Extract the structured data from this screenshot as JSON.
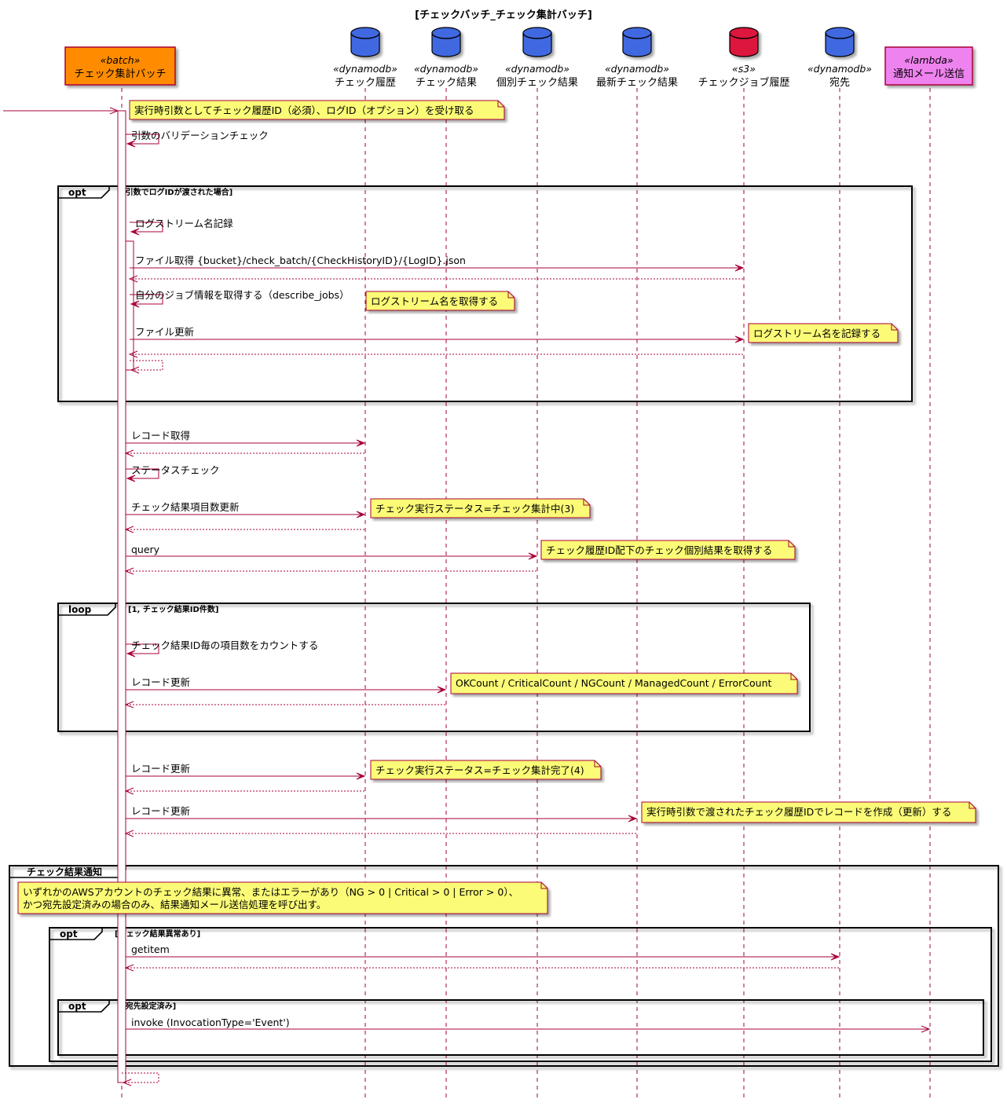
{
  "title": "[チェックバッチ_チェック集計バッチ]",
  "colors": {
    "arrow": "#a80036",
    "note_fill": "#fbfb77",
    "note_stroke": "#a80036",
    "batch": "#ff8c00",
    "lambda": "#ee82ee",
    "dynamodb": "#4169e1",
    "s3": "#dc143c",
    "frame": "#000000"
  },
  "participants": [
    {
      "id": "batch",
      "stereotype": "«batch»",
      "name": "チェック集計バッチ",
      "kind": "box",
      "color": "#ff8c00"
    },
    {
      "id": "hist",
      "stereotype": "«dynamodb»",
      "name": "チェック履歴",
      "kind": "db",
      "color": "#4169e1"
    },
    {
      "id": "result",
      "stereotype": "«dynamodb»",
      "name": "チェック結果",
      "kind": "db",
      "color": "#4169e1"
    },
    {
      "id": "indiv",
      "stereotype": "«dynamodb»",
      "name": "個別チェック結果",
      "kind": "db",
      "color": "#4169e1"
    },
    {
      "id": "latest",
      "stereotype": "«dynamodb»",
      "name": "最新チェック結果",
      "kind": "db",
      "color": "#4169e1"
    },
    {
      "id": "s3",
      "stereotype": "«s3»",
      "name": "チェックジョブ履歴",
      "kind": "db",
      "color": "#dc143c"
    },
    {
      "id": "dest",
      "stereotype": "«dynamodb»",
      "name": "宛先",
      "kind": "db",
      "color": "#4169e1"
    },
    {
      "id": "lambda",
      "stereotype": "«lambda»",
      "name": "通知メール送信",
      "kind": "box",
      "color": "#ee82ee"
    }
  ],
  "messages": [
    {
      "label": "",
      "from": "start",
      "to": "batch",
      "style": "async"
    },
    {
      "label": "引数のバリデーションチェック",
      "from": "batch",
      "to": "batch",
      "style": "self"
    },
    {
      "label": "ログストリーム名記録",
      "from": "batch",
      "to": "batch",
      "style": "self"
    },
    {
      "label": "ファイル取得 {bucket}/check_batch/{CheckHistoryID}/{LogID}.json",
      "from": "batch",
      "to": "s3",
      "style": "sync"
    },
    {
      "label": "",
      "from": "s3",
      "to": "batch",
      "style": "return"
    },
    {
      "label": "自分のジョブ情報を取得する（describe_jobs）",
      "from": "batch",
      "to": "batch",
      "style": "self"
    },
    {
      "label": "ファイル更新",
      "from": "batch",
      "to": "s3",
      "style": "sync"
    },
    {
      "label": "",
      "from": "s3",
      "to": "batch",
      "style": "return"
    },
    {
      "label": "",
      "from": "batch",
      "to": "batch",
      "style": "self-return"
    },
    {
      "label": "レコード取得",
      "from": "batch",
      "to": "hist",
      "style": "sync"
    },
    {
      "label": "",
      "from": "hist",
      "to": "batch",
      "style": "return"
    },
    {
      "label": "ステータスチェック",
      "from": "batch",
      "to": "batch",
      "style": "self"
    },
    {
      "label": "チェック結果項目数更新",
      "from": "batch",
      "to": "hist",
      "style": "sync"
    },
    {
      "label": "",
      "from": "hist",
      "to": "batch",
      "style": "return"
    },
    {
      "label": "query",
      "from": "batch",
      "to": "indiv",
      "style": "sync"
    },
    {
      "label": "",
      "from": "indiv",
      "to": "batch",
      "style": "return"
    },
    {
      "label": "チェック結果ID毎の項目数をカウントする",
      "from": "batch",
      "to": "batch",
      "style": "self"
    },
    {
      "label": "レコード更新",
      "from": "batch",
      "to": "result",
      "style": "sync"
    },
    {
      "label": "",
      "from": "result",
      "to": "batch",
      "style": "return"
    },
    {
      "label": "レコード更新",
      "from": "batch",
      "to": "hist",
      "style": "sync"
    },
    {
      "label": "",
      "from": "hist",
      "to": "batch",
      "style": "return"
    },
    {
      "label": "レコード更新",
      "from": "batch",
      "to": "latest",
      "style": "sync"
    },
    {
      "label": "",
      "from": "latest",
      "to": "batch",
      "style": "return"
    },
    {
      "label": "getitem",
      "from": "batch",
      "to": "dest",
      "style": "sync"
    },
    {
      "label": "",
      "from": "dest",
      "to": "batch",
      "style": "return"
    },
    {
      "label": "invoke (InvocationType='Event')",
      "from": "batch",
      "to": "lambda",
      "style": "async"
    },
    {
      "label": "",
      "from": "batch",
      "to": "batch",
      "style": "self-return"
    }
  ],
  "notes": [
    {
      "lines": [
        "実行時引数としてチェック履歴ID（必須）、ログID（オプション）を受け取る"
      ]
    },
    {
      "lines": [
        "ログストリーム名を取得する"
      ]
    },
    {
      "lines": [
        "ログストリーム名を記録する"
      ]
    },
    {
      "lines": [
        "チェック実行ステータス=チェック集計中(3)"
      ]
    },
    {
      "lines": [
        "チェック履歴ID配下のチェック個別結果を取得する"
      ]
    },
    {
      "lines": [
        "OKCount / CriticalCount / NGCount / ManagedCount / ErrorCount"
      ]
    },
    {
      "lines": [
        "チェック実行ステータス=チェック集計完了(4)"
      ]
    },
    {
      "lines": [
        "実行時引数で渡されたチェック履歴IDでレコードを作成（更新）する"
      ]
    },
    {
      "lines": [
        "いずれかのAWSアカウントのチェック結果に異常、またはエラーがあり（NG > 0 | Critical > 0 | Error > 0）、",
        "かつ宛先設定済みの場合のみ、結果通知メール送信処理を呼び出す。"
      ]
    }
  ],
  "fragments": [
    {
      "keyword": "opt",
      "condition": "[引数でログIDが渡された場合]"
    },
    {
      "keyword": "loop",
      "condition": "[1, チェック結果ID件数]"
    },
    {
      "keyword": "チェック結果通知",
      "condition": ""
    },
    {
      "keyword": "opt",
      "condition": "[チェック結果異常あり]"
    },
    {
      "keyword": "opt",
      "condition": "[宛先設定済み]"
    }
  ]
}
